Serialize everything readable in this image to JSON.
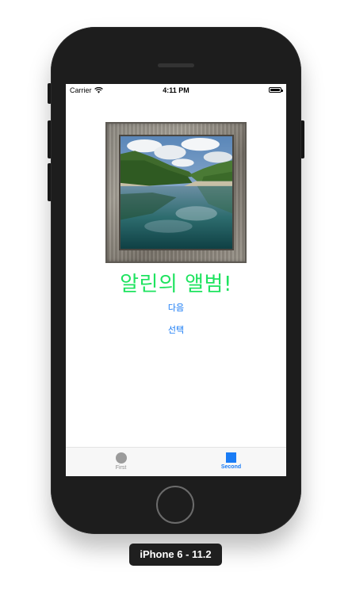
{
  "status_bar": {
    "carrier": "Carrier",
    "time": "4:11 PM",
    "icons": [
      "wifi-icon",
      "battery-icon"
    ]
  },
  "main": {
    "album_title": "알린의 앨범!",
    "next_label": "다음",
    "select_label": "선택",
    "photo_subject": "framed landscape photo of a mountain lake"
  },
  "tab_bar": {
    "tabs": [
      {
        "label": "First",
        "icon": "circle-icon",
        "selected": false
      },
      {
        "label": "Second",
        "icon": "square-icon",
        "selected": true
      }
    ]
  },
  "device": {
    "label": "iPhone 6 - 11.2"
  },
  "colors": {
    "title_green": "#1ee35f",
    "tint_blue": "#1a7cf5",
    "inactive_gray": "#8e8e8e",
    "device_body": "#1d1d1d"
  }
}
